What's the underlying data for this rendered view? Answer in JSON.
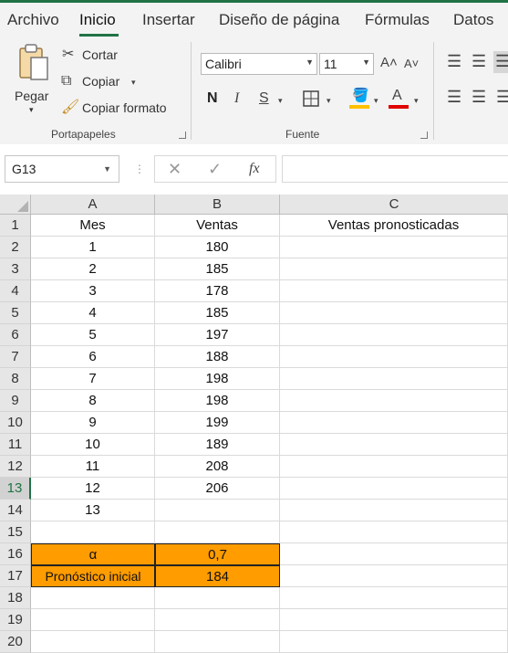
{
  "tabs": [
    "Archivo",
    "Inicio",
    "Insertar",
    "Diseño de página",
    "Fórmulas",
    "Datos"
  ],
  "active_tab": "Inicio",
  "clipboard": {
    "paste": "Pegar",
    "cut": "Cortar",
    "copy": "Copiar",
    "format_painter": "Copiar formato",
    "group_label": "Portapapeles"
  },
  "font": {
    "name": "Calibri",
    "size": "11",
    "bold": "N",
    "italic": "I",
    "underline": "S",
    "group_label": "Fuente",
    "fill_color": "#ffc000",
    "font_color": "#e00000"
  },
  "formula_bar": {
    "name_box": "G13",
    "fx": "fx",
    "value": ""
  },
  "sheet": {
    "columns": [
      "A",
      "B",
      "C"
    ],
    "rows": [
      "1",
      "2",
      "3",
      "4",
      "5",
      "6",
      "7",
      "8",
      "9",
      "10",
      "11",
      "12",
      "13",
      "14",
      "15",
      "16",
      "17",
      "18",
      "19",
      "20"
    ],
    "selected_row": "13",
    "cells": [
      [
        "Mes",
        "Ventas",
        "Ventas pronosticadas"
      ],
      [
        "1",
        "180",
        ""
      ],
      [
        "2",
        "185",
        ""
      ],
      [
        "3",
        "178",
        ""
      ],
      [
        "4",
        "185",
        ""
      ],
      [
        "5",
        "197",
        ""
      ],
      [
        "6",
        "188",
        ""
      ],
      [
        "7",
        "198",
        ""
      ],
      [
        "8",
        "198",
        ""
      ],
      [
        "9",
        "199",
        ""
      ],
      [
        "10",
        "189",
        ""
      ],
      [
        "11",
        "208",
        ""
      ],
      [
        "12",
        "206",
        ""
      ],
      [
        "13",
        "",
        ""
      ],
      [
        "",
        "",
        ""
      ],
      [
        "α",
        "0,7",
        ""
      ],
      [
        "Pronóstico inicial",
        "184",
        ""
      ],
      [
        "",
        "",
        ""
      ],
      [
        "",
        "",
        ""
      ],
      [
        "",
        "",
        ""
      ]
    ],
    "highlight_color": "#ff9c00"
  }
}
